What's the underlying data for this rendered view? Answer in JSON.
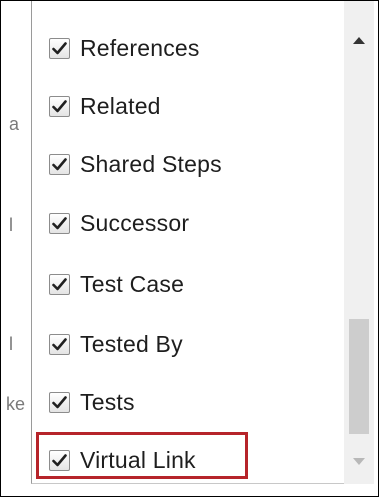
{
  "background_fragments": [
    "a",
    "l",
    "l",
    "ke"
  ],
  "dropdown": {
    "items": [
      {
        "label": "References",
        "checked": true
      },
      {
        "label": "Related",
        "checked": true
      },
      {
        "label": "Shared Steps",
        "checked": true
      },
      {
        "label": "Successor",
        "checked": true
      },
      {
        "label": "Test Case",
        "checked": true
      },
      {
        "label": "Tested By",
        "checked": true
      },
      {
        "label": "Tests",
        "checked": true
      },
      {
        "label": "Virtual Link",
        "checked": true
      }
    ]
  },
  "colors": {
    "highlight": "#b6242a",
    "scroll_thumb": "#cdcdcd",
    "scroll_track": "#f0f0f0"
  },
  "icons": {
    "checkbox": "check-mark",
    "scroll_up": "triangle-up",
    "scroll_down": "triangle-down"
  }
}
